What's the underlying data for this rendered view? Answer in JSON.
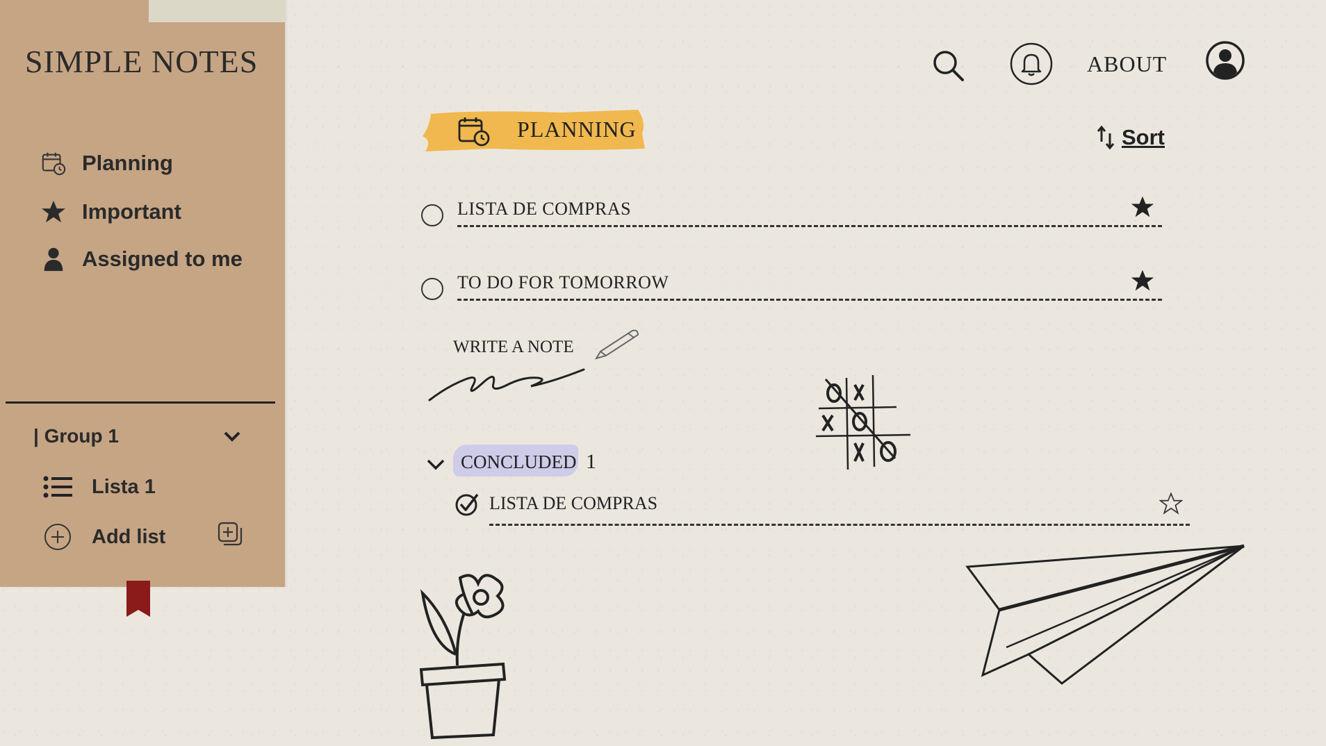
{
  "app": {
    "title": "SIMPLE NOTES"
  },
  "sidebar": {
    "items": [
      {
        "label": "Planning",
        "icon": "calendar-clock-icon"
      },
      {
        "label": "Important",
        "icon": "star-icon"
      },
      {
        "label": "Assigned to me",
        "icon": "person-icon"
      }
    ],
    "group": {
      "label": "| Group 1",
      "icon": "chevron-down-icon"
    },
    "lists": [
      {
        "label": "Lista 1",
        "icon": "list-icon"
      }
    ],
    "add_list": {
      "label": "Add list",
      "icon": "plus-circle-icon",
      "secondary_icon": "add-group-icon"
    }
  },
  "header": {
    "about_label": "ABOUT",
    "icons": [
      "search-icon",
      "bell-icon",
      "user-icon"
    ]
  },
  "main": {
    "title": "PLANNING",
    "sort_label": "Sort",
    "tasks": [
      {
        "title": "LISTA DE COMPRAS",
        "important": true,
        "completed": false
      },
      {
        "title": "TO DO FOR TOMORROW",
        "important": true,
        "completed": false
      }
    ],
    "write_note_placeholder": "WRITE A NOTE",
    "concluded": {
      "label": "CONCLUDED",
      "count": "1",
      "tasks": [
        {
          "title": "LISTA DE COMPRAS",
          "important": false,
          "completed": true
        }
      ]
    }
  },
  "colors": {
    "sidebar_bg": "#c6a585",
    "page_bg": "#ebe7df",
    "planning_highlight": "#f0b84e",
    "concluded_highlight": "#c9c7ea",
    "bookmark": "#8b1a1a"
  }
}
